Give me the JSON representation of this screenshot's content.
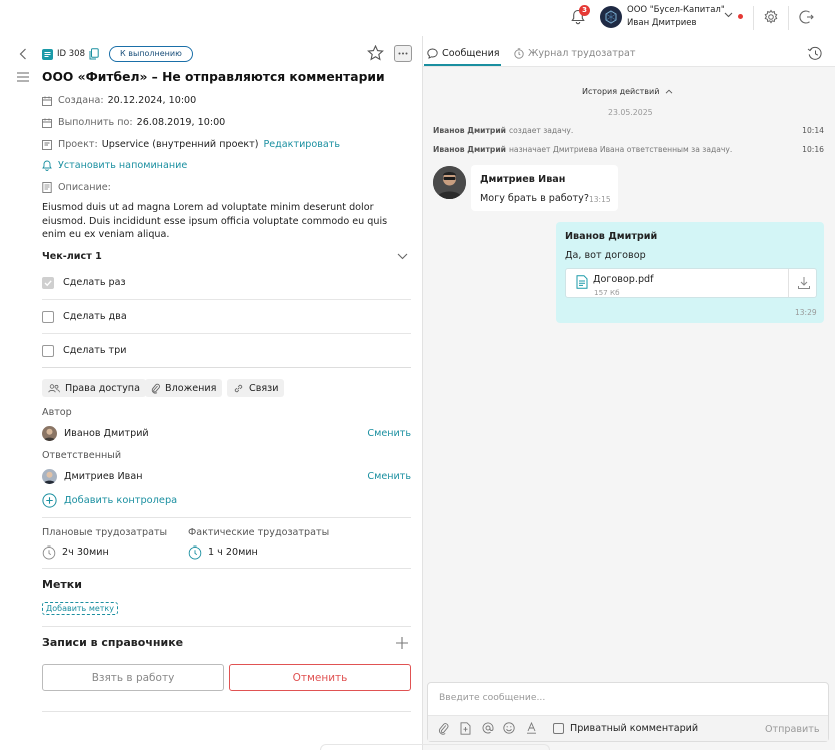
{
  "topbar": {
    "notification_count": "3",
    "org_name": "ООО \"Бусел-Капитал\"",
    "user_name": "Иван Дмитриев"
  },
  "task": {
    "id": "ID 308",
    "status": "К выполнению",
    "title": "ООО «Фитбел» – Не отправляются комментарии",
    "created_label": "Создана:",
    "created_value": "20.12.2024, 10:00",
    "due_label": "Выполнить по:",
    "due_value": "26.08.2019, 10:00",
    "project_label": "Проект:",
    "project_value": "Upservice (внутренний проект)",
    "project_edit": "Редактировать",
    "reminder": "Установить напоминание",
    "description_label": "Описание:",
    "description": "Eiusmod duis ut ad magna Lorem ad voluptate minim deserunt dolor eiusmod. Duis incididunt esse ipsum officia voluptate commodo eu quis enim eu ex veniam aliqua."
  },
  "checklist": {
    "title": "Чек-лист 1",
    "items": [
      {
        "label": "Сделать раз",
        "checked": true
      },
      {
        "label": "Сделать два",
        "checked": false
      },
      {
        "label": "Сделать три",
        "checked": false
      }
    ]
  },
  "chips": {
    "access": "Права доступа",
    "attachments": "Вложения",
    "links": "Связи"
  },
  "people": {
    "author_label": "Автор",
    "author_name": "Иванов Дмитрий",
    "responsible_label": "Ответственный",
    "responsible_name": "Дмитриев Иван",
    "change": "Сменить",
    "add_controller": "Добавить контролера"
  },
  "labor": {
    "planned_label": "Плановые трудозатраты",
    "planned_value": "2ч 30мин",
    "actual_label": "Фактические трудозатраты",
    "actual_value": "1 ч 20мин"
  },
  "tags": {
    "title": "Метки",
    "add": "Добавить метку"
  },
  "directory": {
    "title": "Записи в справочнике"
  },
  "actions": {
    "take": "Взять в работу",
    "cancel": "Отменить"
  },
  "chat": {
    "tab_messages": "Сообщения",
    "tab_journal": "Журнал трудозатрат",
    "history": "История действий",
    "date": "23.05.2025",
    "log": [
      {
        "who": "Иванов Дмитрий",
        "action": "создает задачу.",
        "time": "10:14"
      },
      {
        "who": "Иванов Дмитрий",
        "action": "назначает Дмитриева Ивана ответственным за задачу.",
        "time": "10:16"
      }
    ],
    "incoming": {
      "name": "Дмитриев Иван",
      "text": "Могу брать в работу?",
      "time": "13:15"
    },
    "outgoing": {
      "name": "Иванов Дмитрий",
      "text": "Да, вот договор",
      "file_name": "Договор.pdf",
      "file_size": "157 Кб",
      "time": "13:29"
    },
    "composer_placeholder": "Введите сообщение...",
    "private_comment": "Приватный комментарий",
    "send": "Отправить"
  },
  "colors": {
    "accent": "#1a8fa0",
    "danger": "#e05252",
    "outgoing_bubble": "#d3f5f6",
    "badge": "#e53935"
  }
}
